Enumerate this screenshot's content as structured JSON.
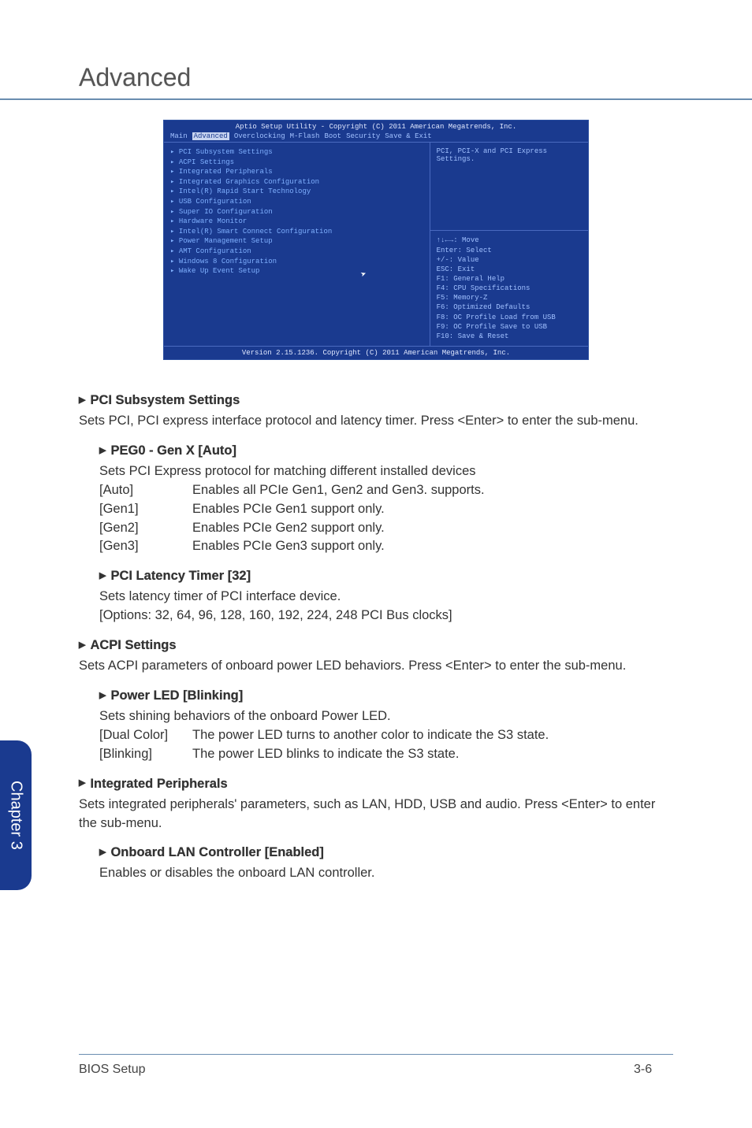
{
  "page_title": "Advanced",
  "bios": {
    "header": "Aptio Setup Utility - Copyright (C) 2011 American Megatrends, Inc.",
    "menu": [
      "Main",
      "Advanced",
      "Overclocking",
      "M-Flash",
      "Boot",
      "Security",
      "Save & Exit"
    ],
    "menu_active": "Advanced",
    "left_items": [
      "PCI Subsystem Settings",
      "ACPI Settings",
      "Integrated Peripherals",
      "Integrated Graphics Configuration",
      "Intel(R) Rapid Start Technology",
      "USB Configuration",
      "Super IO Configuration",
      "Hardware Monitor",
      "Intel(R) Smart Connect Configuration",
      "Power Management Setup",
      "AMT Configuration",
      "Windows 8 Configuration",
      "Wake Up Event Setup"
    ],
    "help_top": "PCI, PCI-X and PCI Express Settings.",
    "help_keys": [
      "↑↓←→: Move",
      "Enter: Select",
      "+/-: Value",
      "ESC: Exit",
      "F1: General Help",
      "F4: CPU Specifications",
      "F5: Memory-Z",
      "F6: Optimized Defaults",
      "F8: OC Profile Load from USB",
      "F9: OC Profile Save to USB",
      "F10: Save & Reset"
    ],
    "footer": "Version 2.15.1236. Copyright (C) 2011 American Megatrends, Inc."
  },
  "sections": {
    "pci_subsystem": {
      "title": "PCI Subsystem Settings",
      "desc": "Sets PCI, PCI express interface protocol and latency timer. Press <Enter> to enter the sub-menu."
    },
    "peg0": {
      "title": "PEG0 - Gen X [Auto]",
      "desc": "Sets PCI Express protocol for matching different installed devices",
      "opts": [
        {
          "k": "[Auto]",
          "v": "Enables all PCIe Gen1, Gen2 and Gen3. supports."
        },
        {
          "k": "[Gen1]",
          "v": "Enables PCIe Gen1 support only."
        },
        {
          "k": "[Gen2]",
          "v": "Enables PCIe Gen2 support only."
        },
        {
          "k": "[Gen3]",
          "v": "Enables PCIe Gen3 support only."
        }
      ]
    },
    "pci_latency": {
      "title": "PCI Latency Timer [32]",
      "desc": "Sets latency timer of PCI interface device.",
      "opts_line": "[Options: 32, 64, 96, 128, 160, 192, 224, 248 PCI Bus clocks]"
    },
    "acpi": {
      "title": "ACPI Settings",
      "desc": "Sets ACPI parameters of onboard power LED behaviors. Press <Enter> to enter the sub-menu."
    },
    "power_led": {
      "title": "Power LED [Blinking]",
      "desc": "Sets shining behaviors of the onboard Power LED.",
      "opts": [
        {
          "k": "[Dual Color]",
          "v": "The power LED turns to another color to indicate the S3 state."
        },
        {
          "k": "[Blinking]",
          "v": "The power LED blinks to indicate the S3 state."
        }
      ]
    },
    "integrated_periph": {
      "title": "Integrated Peripherals",
      "desc": "Sets integrated peripherals' parameters, such as LAN, HDD, USB and audio. Press <Enter> to enter the sub-menu."
    },
    "onboard_lan": {
      "title": "Onboard LAN Controller [Enabled]",
      "desc": "Enables or disables the onboard LAN controller."
    }
  },
  "side_tab": "Chapter 3",
  "footer": {
    "left": "BIOS Setup",
    "page": "3-6"
  }
}
